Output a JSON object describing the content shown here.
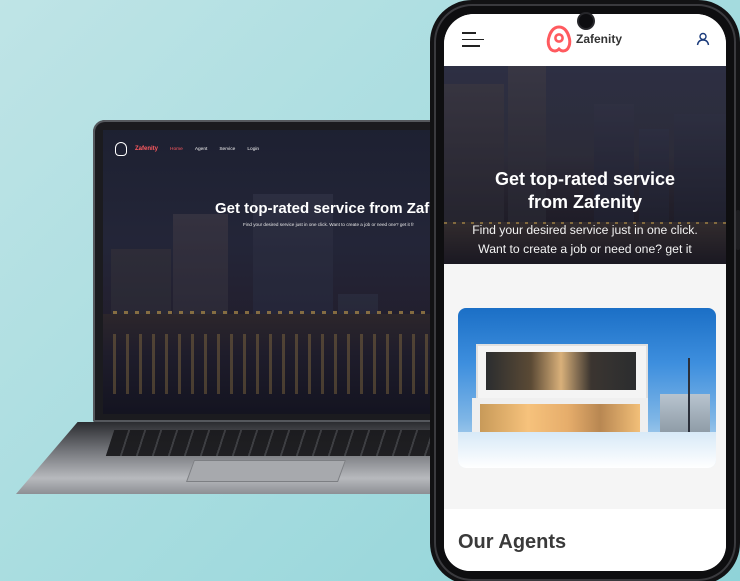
{
  "laptop": {
    "brand": "Zafenity",
    "nav": [
      "Home",
      "Agent",
      "Service",
      "Login"
    ],
    "hero_title": "Get top-rated service from Zaf",
    "hero_subtitle": "Find your desired service just in one click. Want to create a job or need one? get it fr"
  },
  "phone": {
    "brand": "Zafenity",
    "hero_title_line1": "Get top-rated service",
    "hero_title_line2": "from Zafenity",
    "hero_sub_line1": "Find your desired service just in one click.",
    "hero_sub_line2": "Want to create a job or need one? get it",
    "section_title": "Our Agents"
  },
  "colors": {
    "brand_accent": "#ff5a5f",
    "background": "#a9dde0"
  },
  "icons": {
    "logo": "airbnb-style-logo-icon",
    "menu": "hamburger-menu-icon",
    "user": "user-icon"
  }
}
